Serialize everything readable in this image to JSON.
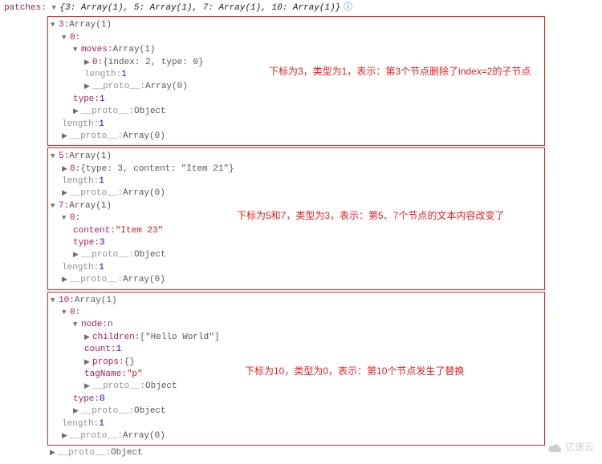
{
  "root": {
    "label": "patches:",
    "summary": "{3: Array(1), 5: Array(1), 7: Array(1), 10: Array(1)}",
    "info_icon": "ⓘ"
  },
  "box1": {
    "k3": "3:",
    "k3_type": "Array(1)",
    "idx0": "0:",
    "moves_k": "moves:",
    "moves_t": "Array(1)",
    "moves_0": "0:",
    "moves_0_v": "{index: 2, type: 0}",
    "len_k": "length:",
    "len_v": "1",
    "proto_k": "__proto__:",
    "proto_v": "Array(0)",
    "type_k": "type:",
    "type_v": "1",
    "proto_obj": "Object",
    "len2_v": "1",
    "proto2_v": "Array(0)",
    "anno": "下标为3，类型为1，表示：第3个节点删除了index=2的子节点"
  },
  "box2": {
    "k5": "5:",
    "k5_t": "Array(1)",
    "k5_0": "0:",
    "k5_0v": "{type: 3, content: \"Item 21\"}",
    "len_k": "length:",
    "len_v": "1",
    "proto_k": "__proto__:",
    "proto_v": "Array(0)",
    "k7": "7:",
    "k7_t": "Array(1)",
    "k7_0": "0:",
    "content_k": "content:",
    "content_v": "\"Item 23\"",
    "type_k": "type:",
    "type_v": "3",
    "proto_obj": "Object",
    "len2_v": "1",
    "proto2_v": "Array(0)",
    "anno": "下标为5和7，类型为3，表示：第5、7个节点的文本内容改变了"
  },
  "box3": {
    "k10": "10:",
    "k10_t": "Array(1)",
    "k10_0": "0:",
    "node_k": "node:",
    "node_v": "n",
    "children_k": "children:",
    "children_v": "[\"Hello World\"]",
    "count_k": "count:",
    "count_v": "1",
    "props_k": "props:",
    "props_v": "{}",
    "tag_k": "tagName:",
    "tag_v": "\"p\"",
    "proto_k": "__proto__:",
    "proto_obj": "Object",
    "type_k": "type:",
    "type_v": "0",
    "len_k": "length:",
    "len_v": "1",
    "proto_v": "Array(0)",
    "anno": "下标为10，类型为0，表示：第10个节点发生了替换"
  },
  "tail_proto_k": "__proto__:",
  "tail_proto_v": "Object",
  "watermark": "亿速云"
}
